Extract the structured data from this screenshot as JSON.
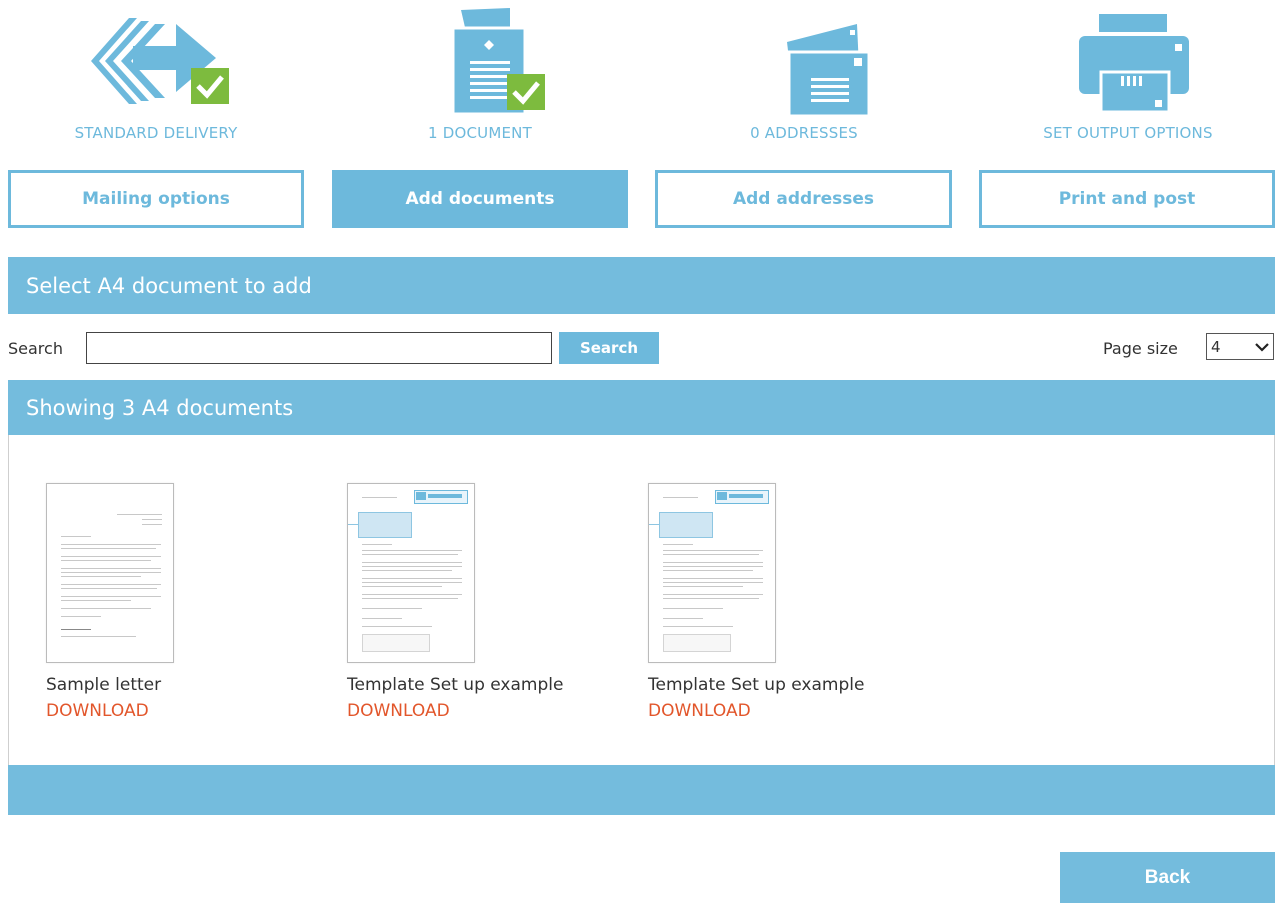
{
  "steps": [
    {
      "caption": "STANDARD DELIVERY",
      "icon": "delivery-arrow-icon"
    },
    {
      "caption": "1 DOCUMENT",
      "icon": "document-icon"
    },
    {
      "caption": "0 ADDRESSES",
      "icon": "envelopes-icon"
    },
    {
      "caption": "SET OUTPUT OPTIONS",
      "icon": "printer-icon"
    }
  ],
  "tabs": [
    {
      "label": "Mailing options",
      "active": false
    },
    {
      "label": "Add documents",
      "active": true
    },
    {
      "label": "Add addresses",
      "active": false
    },
    {
      "label": "Print and post",
      "active": false
    }
  ],
  "select_header": "Select A4 document to add",
  "search": {
    "label": "Search",
    "value": "",
    "placeholder": "",
    "button": "Search"
  },
  "page_size": {
    "label": "Page size",
    "value": "4"
  },
  "results_header": "Showing 3 A4 documents",
  "documents": [
    {
      "name": "Sample letter",
      "download": "DOWNLOAD"
    },
    {
      "name": "Template Set up example",
      "download": "DOWNLOAD"
    },
    {
      "name": "Template Set up example",
      "download": "DOWNLOAD"
    }
  ],
  "back_label": "Back",
  "colors": {
    "accent": "#74bcdd",
    "check": "#7dbb3e",
    "download": "#e2562b"
  }
}
